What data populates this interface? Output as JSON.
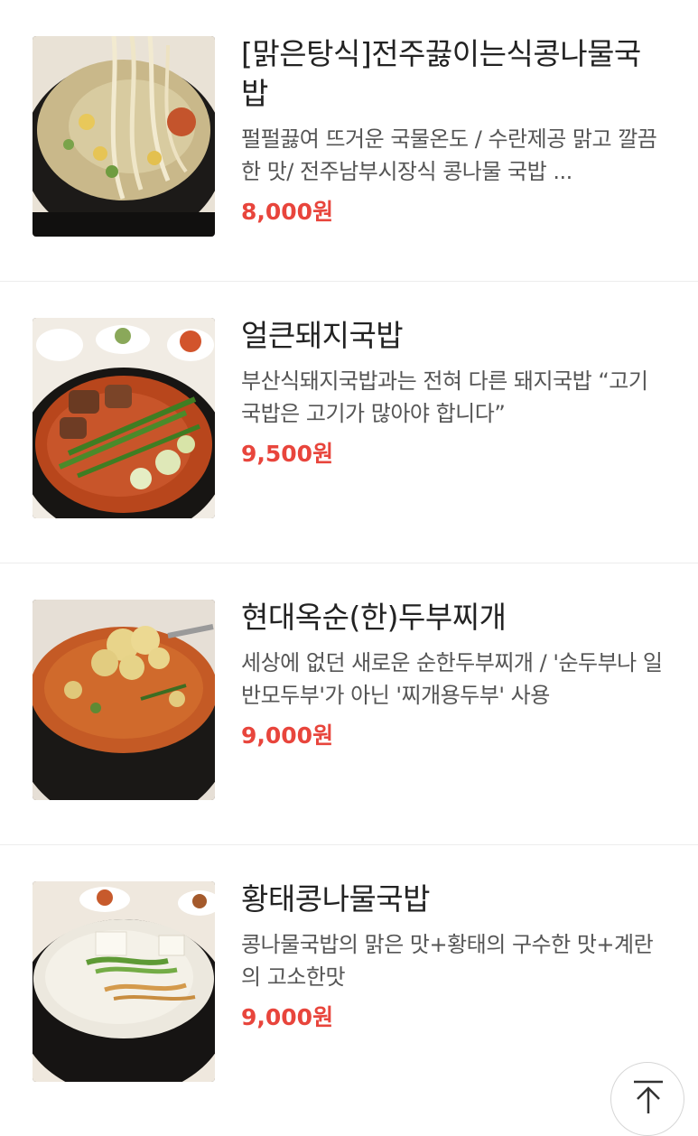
{
  "price_color": "#e8453c",
  "menu": [
    {
      "name": "[맑은탕식]전주끓이는식콩나물국밥",
      "description": "펄펄끓여 뜨거운 국물온도 / 수란제공 맑고 깔끔한 맛/ 전주남부시장식 콩나물 국밥 ...",
      "price": "8,000원",
      "image": "bean-sprout-soup-photo"
    },
    {
      "name": "얼큰돼지국밥",
      "description": "부산식돼지국밥과는 전혀 다른 돼지국밥 “고기국밥은 고기가 많아야 합니다”",
      "price": "9,500원",
      "image": "spicy-pork-soup-photo"
    },
    {
      "name": "현대옥순(한)두부찌개",
      "description": "세상에 없던 새로운 순한두부찌개 / '순두부나 일반모두부'가 아닌 '찌개용두부' 사용",
      "price": "9,000원",
      "image": "tofu-stew-photo"
    },
    {
      "name": "황태콩나물국밥",
      "description": "콩나물국밥의 맑은 맛+황태의 구수한 맛+계란의 고소한맛",
      "price": "9,000원",
      "image": "pollack-bean-sprout-soup-photo"
    }
  ],
  "scroll_top_icon": "arrow-up-to-top-icon"
}
